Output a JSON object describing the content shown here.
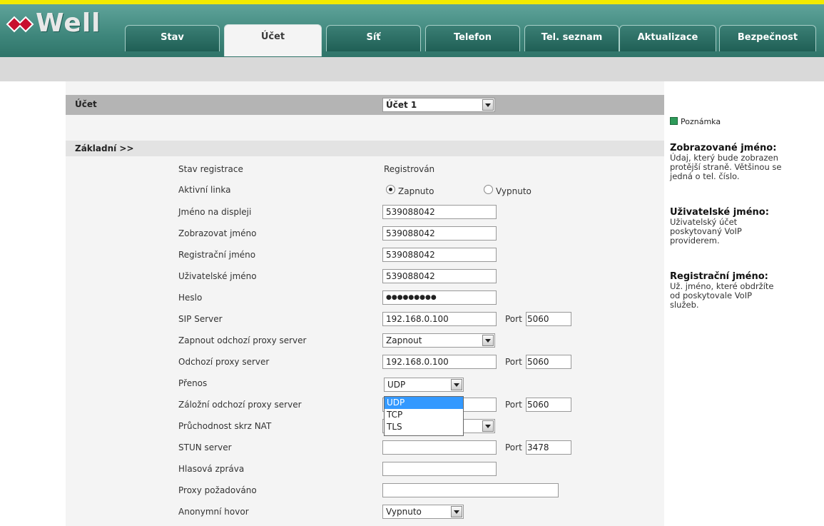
{
  "brand": {
    "logo_text": "Well"
  },
  "tabs": [
    {
      "label": "Stav"
    },
    {
      "label": "Účet"
    },
    {
      "label": "Síť"
    },
    {
      "label": "Telefon"
    },
    {
      "label": "Tel. seznam"
    },
    {
      "label": "Aktualizace"
    },
    {
      "label": "Bezpečnost"
    }
  ],
  "account": {
    "label": "Účet",
    "selected": "Účet 1"
  },
  "section": {
    "title": "Základní >>"
  },
  "fields": {
    "reg_status": {
      "label": "Stav registrace",
      "value": "Registrován"
    },
    "active_line": {
      "label": "Aktivní linka",
      "on": "Zapnuto",
      "off": "Vypnuto"
    },
    "display_name": {
      "label": "Jméno na displeji",
      "value": "539088042"
    },
    "show_name": {
      "label": "Zobrazovat jméno",
      "value": "539088042"
    },
    "reg_name": {
      "label": "Registrační jméno",
      "value": "539088042"
    },
    "user_name": {
      "label": "Uživatelské jméno",
      "value": "539088042"
    },
    "password": {
      "label": "Heslo",
      "value": "●●●●●●●●●"
    },
    "sip_server": {
      "label": "SIP Server",
      "value": "192.168.0.100",
      "port_label": "Port",
      "port": "5060"
    },
    "outbound_enable": {
      "label": "Zapnout odchozí proxy server",
      "value": "Zapnout"
    },
    "outbound_proxy": {
      "label": "Odchozí proxy server",
      "value": "192.168.0.100",
      "port_label": "Port",
      "port": "5060"
    },
    "transport": {
      "label": "Přenos",
      "value": "UDP",
      "options": [
        "UDP",
        "TCP",
        "TLS"
      ]
    },
    "backup_proxy": {
      "label": "Záložní odchozí proxy server",
      "value": "",
      "port_label": "Port",
      "port": "5060"
    },
    "nat": {
      "label": "Průchodnost skrz NAT",
      "value": ""
    },
    "stun": {
      "label": "STUN server",
      "value": "",
      "port_label": "Port",
      "port": "3478"
    },
    "voicemail": {
      "label": "Hlasová zpráva",
      "value": ""
    },
    "proxy_req": {
      "label": "Proxy požadováno",
      "value": ""
    },
    "anon_call": {
      "label": "Anonymní hovor",
      "value": "Vypnuto"
    }
  },
  "sidebar": {
    "note_title": "Poznámka",
    "items": [
      {
        "title": "Zobrazované jméno:",
        "lines": [
          "Údaj, který bude zobrazen",
          "protější straně. Většinou se",
          "jedná o tel. číslo."
        ]
      },
      {
        "title": "Uživatelské jméno:",
        "lines": [
          "Uživatelský účet",
          "poskytovaný VoIP",
          "providerem."
        ]
      },
      {
        "title": "Registrační jméno:",
        "lines": [
          "Už. jméno, které obdržíte",
          "od poskytovale VoIP",
          "služeb."
        ]
      }
    ]
  },
  "colors": {
    "header": "#3e867b",
    "accent_yellow": "#f2ea00",
    "highlight": "#3399ff"
  }
}
